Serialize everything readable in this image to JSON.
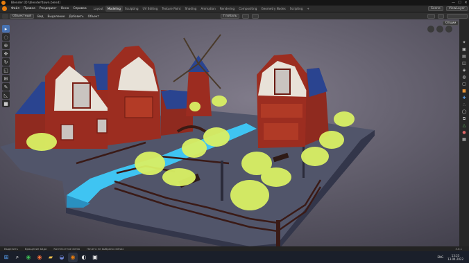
{
  "window": {
    "title": "Blender [D:\\blender\\town.blend]",
    "min": "—",
    "max": "☐",
    "close": "✕"
  },
  "menu": {
    "items": [
      "Файл",
      "Правка",
      "Рендеринг",
      "Окно",
      "Справка"
    ],
    "workspaces": [
      "Layout",
      "Modeling",
      "Sculpting",
      "UV Editing",
      "Texture Paint",
      "Shading",
      "Animation",
      "Rendering",
      "Compositing",
      "Geometry Nodes",
      "Scripting"
    ],
    "active_workspace": "Modeling",
    "add_tab": "+",
    "scene": "Scene",
    "view_layer": "ViewLayer"
  },
  "header": {
    "mode": "Объектный",
    "items": [
      "Вид",
      "Выделение",
      "Добавить",
      "Объект"
    ],
    "orientation": "Глобаль",
    "options": "Опции"
  },
  "toolbar": {
    "icons": [
      "select-icon",
      "select-box-icon",
      "cursor-icon",
      "move-icon",
      "rotate-icon",
      "scale-icon",
      "transform-icon",
      "annotate-icon",
      "measure-icon",
      "add-cube-icon"
    ]
  },
  "right_strip": {
    "icons": [
      "tool-icon",
      "render-icon",
      "output-icon",
      "view-layer-icon",
      "scene-icon",
      "world-icon",
      "collection-icon",
      "object-icon",
      "modifier-icon",
      "particles-icon",
      "physics-icon",
      "constraints-icon",
      "data-icon",
      "material-icon",
      "texture-icon"
    ]
  },
  "status": {
    "items": [
      "Выделить",
      "Вращение вида",
      "Контекстное меню",
      "Ничего не выбрано сейчас"
    ],
    "version": "3.0.1"
  },
  "taskbar": {
    "apps": [
      "windows-icon",
      "search-icon",
      "chrome-icon",
      "firefox-icon",
      "folder-icon",
      "discord-icon",
      "blender-icon",
      "steam-icon",
      "photo-icon"
    ],
    "tray": {
      "lang": "ENG",
      "time": "13:23",
      "date": "13.04.2022"
    }
  },
  "colors": {
    "accent": "#4772b3",
    "bg_viewport": "#5a5666",
    "water": "#3fc4f2",
    "brick": "#9a2a1e",
    "roof": "#2c4aa3",
    "tree": "#d9f064",
    "ground": "#4e5266"
  }
}
